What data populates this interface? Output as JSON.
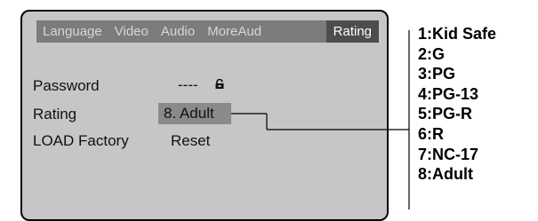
{
  "tabs": [
    {
      "label": "Language",
      "active": false
    },
    {
      "label": "Video",
      "active": false
    },
    {
      "label": "Audio",
      "active": false
    },
    {
      "label": "MoreAud",
      "active": false
    },
    {
      "label": "Rating",
      "active": true
    }
  ],
  "settings": {
    "password_label": "Password",
    "password_value": "----",
    "rating_label": "Rating",
    "rating_value": "8. Adult",
    "load_factory_label": "LOAD Factory",
    "load_factory_value": "Reset"
  },
  "rating_options": [
    "1:Kid Safe",
    "2:G",
    "3:PG",
    "4:PG-13",
    "5:PG-R",
    "6:R",
    "7:NC-17",
    "8:Adult"
  ],
  "icons": {
    "lock": "lock-icon"
  },
  "colors": {
    "panel_bg": "#c6c6c6",
    "tabbar_bg": "#7c7c7c",
    "active_tab_bg": "#4d4d4d",
    "highlight_bg": "#8a8a8a"
  }
}
